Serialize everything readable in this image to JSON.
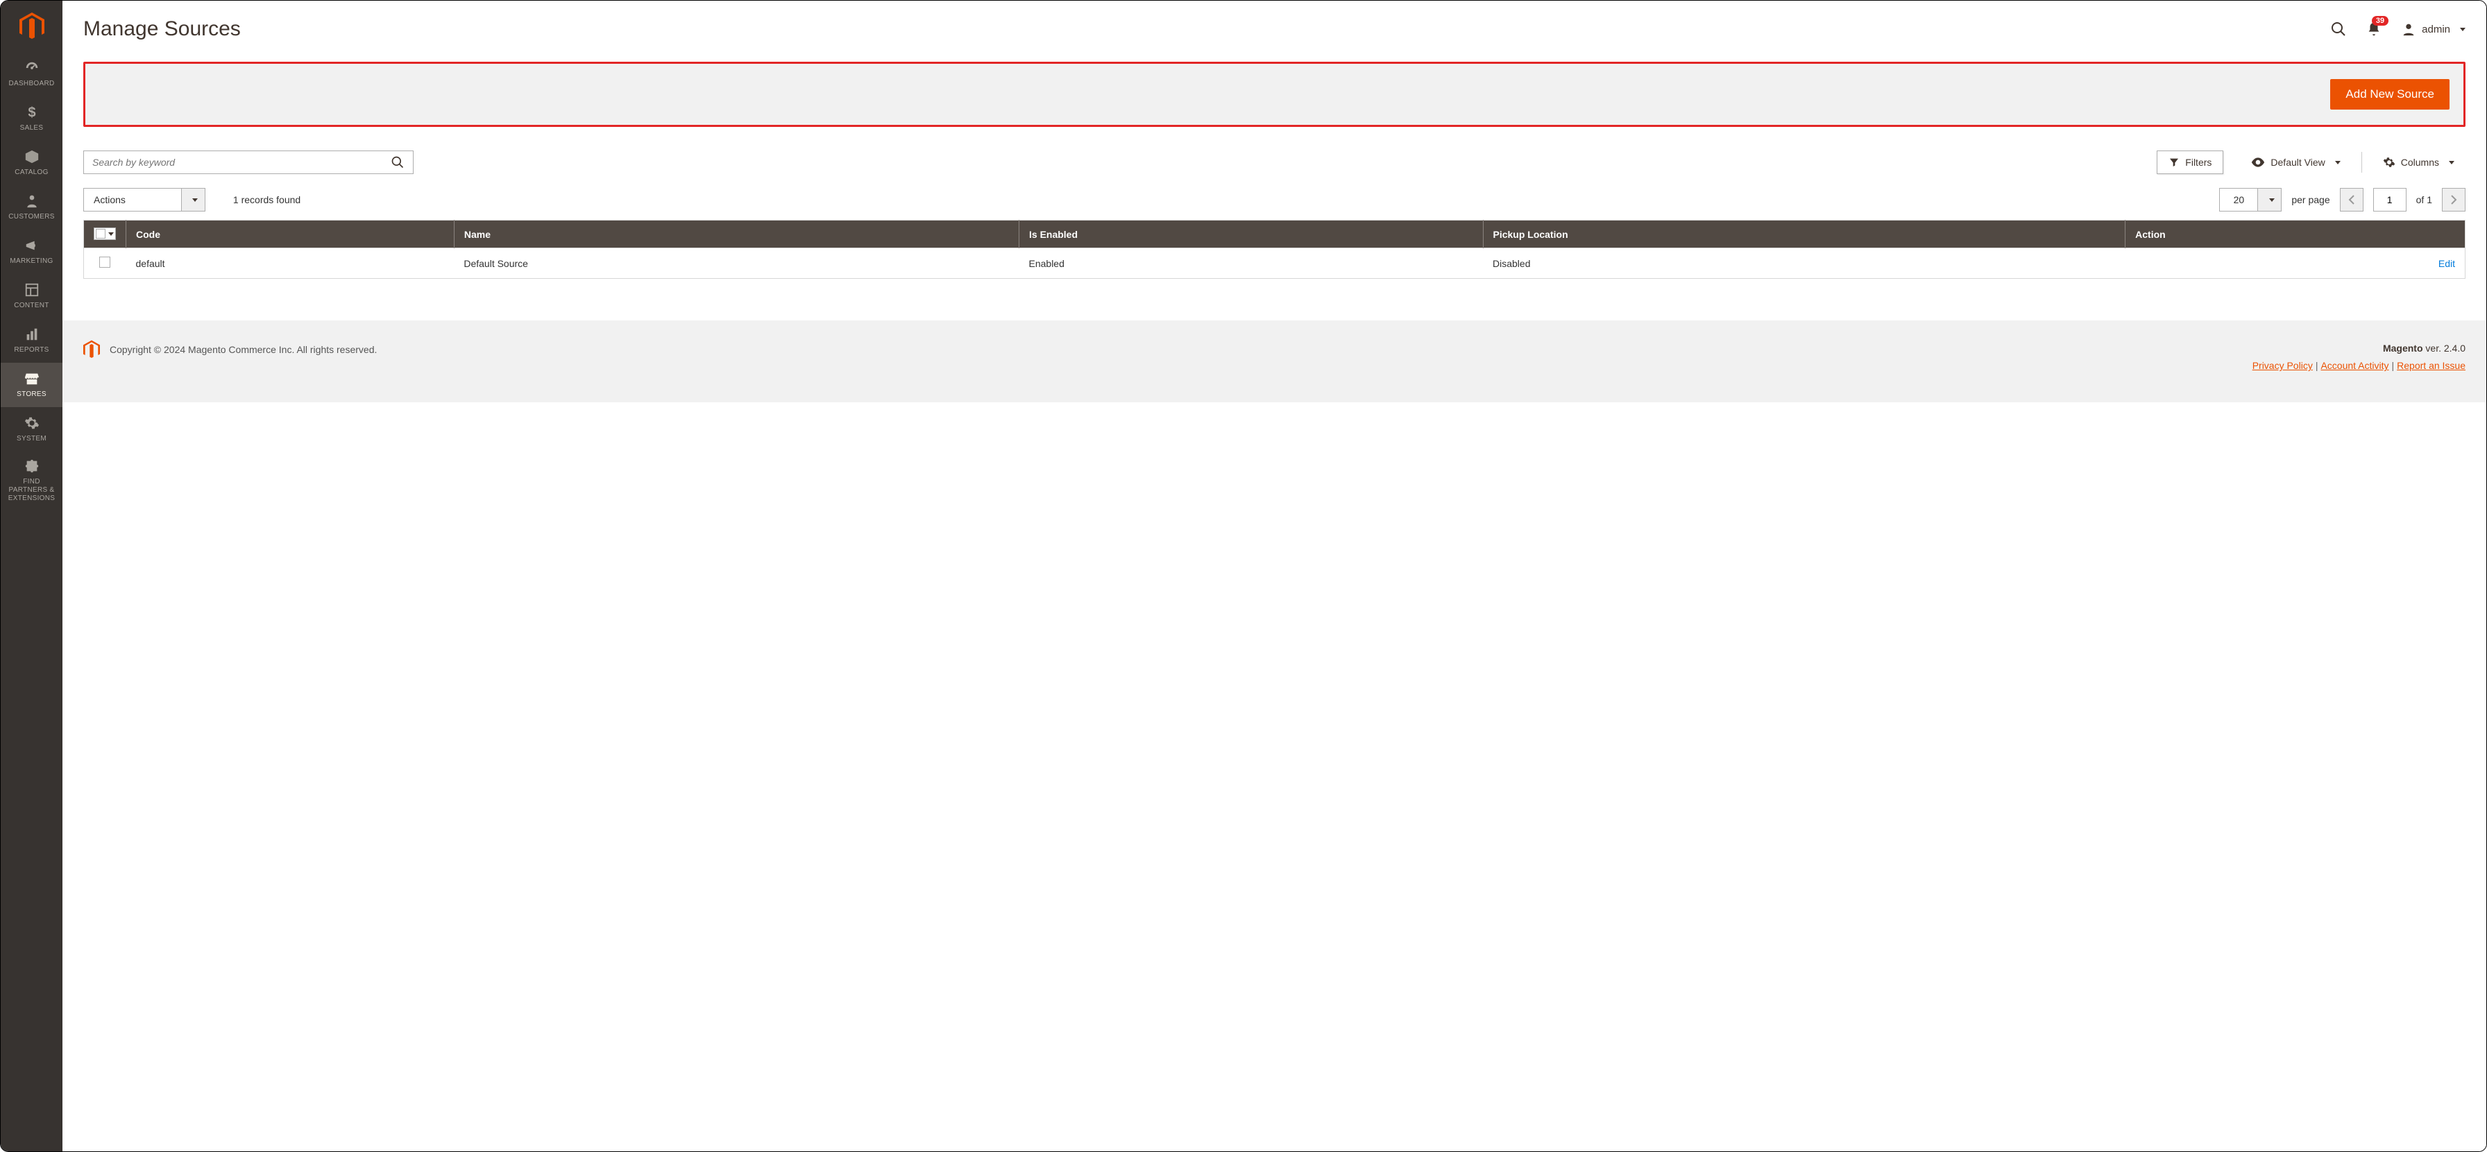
{
  "sidebar": {
    "items": [
      {
        "label": "DASHBOARD"
      },
      {
        "label": "SALES"
      },
      {
        "label": "CATALOG"
      },
      {
        "label": "CUSTOMERS"
      },
      {
        "label": "MARKETING"
      },
      {
        "label": "CONTENT"
      },
      {
        "label": "REPORTS"
      },
      {
        "label": "STORES"
      },
      {
        "label": "SYSTEM"
      },
      {
        "label": "FIND PARTNERS & EXTENSIONS"
      }
    ]
  },
  "header": {
    "title": "Manage Sources",
    "notification_count": "39",
    "user_name": "admin"
  },
  "action_bar": {
    "add_button": "Add New Source"
  },
  "toolbar": {
    "search_placeholder": "Search by keyword",
    "filters": "Filters",
    "default_view": "Default View",
    "columns": "Columns"
  },
  "grid": {
    "actions_label": "Actions",
    "records_found": "1 records found",
    "page_size": "20",
    "per_page": "per page",
    "current_page": "1",
    "total_pages": "of 1",
    "columns": {
      "code": "Code",
      "name": "Name",
      "is_enabled": "Is Enabled",
      "pickup_location": "Pickup Location",
      "action": "Action"
    },
    "rows": [
      {
        "code": "default",
        "name": "Default Source",
        "is_enabled": "Enabled",
        "pickup_location": "Disabled",
        "action": "Edit"
      }
    ]
  },
  "footer": {
    "copyright": "Copyright © 2024 Magento Commerce Inc. All rights reserved.",
    "product": "Magento",
    "version": " ver. 2.4.0",
    "privacy": "Privacy Policy",
    "activity": "Account Activity",
    "report": "Report an Issue"
  }
}
